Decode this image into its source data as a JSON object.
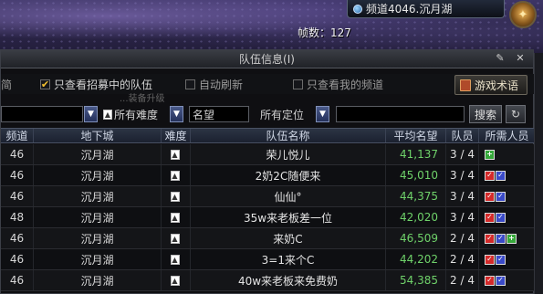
{
  "hud": {
    "channel": "频道4046.沉月湖",
    "fps_label": "帧数：127"
  },
  "panel": {
    "title": "队伍信息(I)",
    "pin_icon": "pin-icon",
    "close_icon": "close-icon"
  },
  "filters": {
    "left_partial": "简",
    "recruiting_only": {
      "label": "只查看招募中的队伍",
      "checked": true
    },
    "auto_refresh": {
      "label": "自动刷新",
      "checked": false
    },
    "my_channel_only": {
      "label": "只查看我的频道",
      "checked": false
    },
    "guide_button": "游戏术语",
    "overlay_text": "...装备升级"
  },
  "search": {
    "difficulty_select": "所有难度",
    "reputation_placeholder": "名望",
    "position_select": "所有定位",
    "keyword_value": "",
    "search_button": "搜索",
    "refresh_icon": "refresh-icon"
  },
  "table": {
    "headers": [
      "频道",
      "地下城",
      "难度",
      "队伍名称",
      "平均名望",
      "队员",
      "所需人员"
    ],
    "rows": [
      {
        "channel": "46",
        "dungeon": "沉月湖",
        "name": "荣儿悦儿",
        "reputation": "41,137",
        "members": "3 / 4",
        "needs": [
          "green"
        ]
      },
      {
        "channel": "46",
        "dungeon": "沉月湖",
        "name": "2奶2C随便来",
        "reputation": "45,010",
        "members": "3 / 4",
        "needs": [
          "red",
          "blue"
        ]
      },
      {
        "channel": "46",
        "dungeon": "沉月湖",
        "name": "仙仙°",
        "reputation": "44,375",
        "members": "3 / 4",
        "needs": [
          "red",
          "blue"
        ]
      },
      {
        "channel": "48",
        "dungeon": "沉月湖",
        "name": "35w来老板差一位",
        "reputation": "42,020",
        "members": "3 / 4",
        "needs": [
          "red",
          "blue"
        ]
      },
      {
        "channel": "46",
        "dungeon": "沉月湖",
        "name": "来奶C",
        "reputation": "46,509",
        "members": "2 / 4",
        "needs": [
          "red",
          "blue",
          "green"
        ]
      },
      {
        "channel": "46",
        "dungeon": "沉月湖",
        "name": "3=1来个C",
        "reputation": "44,202",
        "members": "2 / 4",
        "needs": [
          "red",
          "blue"
        ]
      },
      {
        "channel": "46",
        "dungeon": "沉月湖",
        "name": "40w来老板来免费奶",
        "reputation": "54,385",
        "members": "2 / 4",
        "needs": [
          "red",
          "blue"
        ]
      }
    ]
  },
  "colors": {
    "reputation_green": "#6fd26a",
    "check_gold": "#f3c030",
    "role_red": "#d42a2a",
    "role_blue": "#3a4ac8",
    "role_green": "#36a83a"
  }
}
